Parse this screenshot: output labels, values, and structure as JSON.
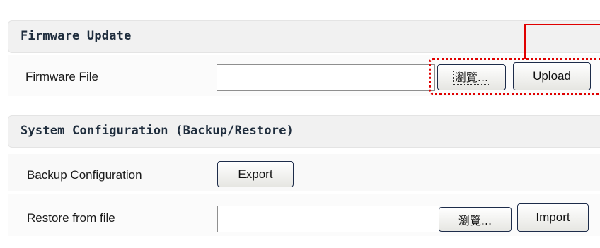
{
  "firmware_update": {
    "title": "Firmware Update",
    "file_label": "Firmware File",
    "file_value": "",
    "browse_label": "瀏覽...",
    "upload_label": "Upload"
  },
  "system_configuration": {
    "title": "System Configuration (Backup/Restore)",
    "backup_label": "Backup Configuration",
    "export_label": "Export",
    "restore_label": "Restore from file",
    "restore_file_value": "",
    "browse_label": "瀏覽...",
    "import_label": "Import"
  },
  "colors": {
    "highlight": "#e00000",
    "header_bg": "#f1f1f1",
    "button_border": "#1d2c4a"
  }
}
